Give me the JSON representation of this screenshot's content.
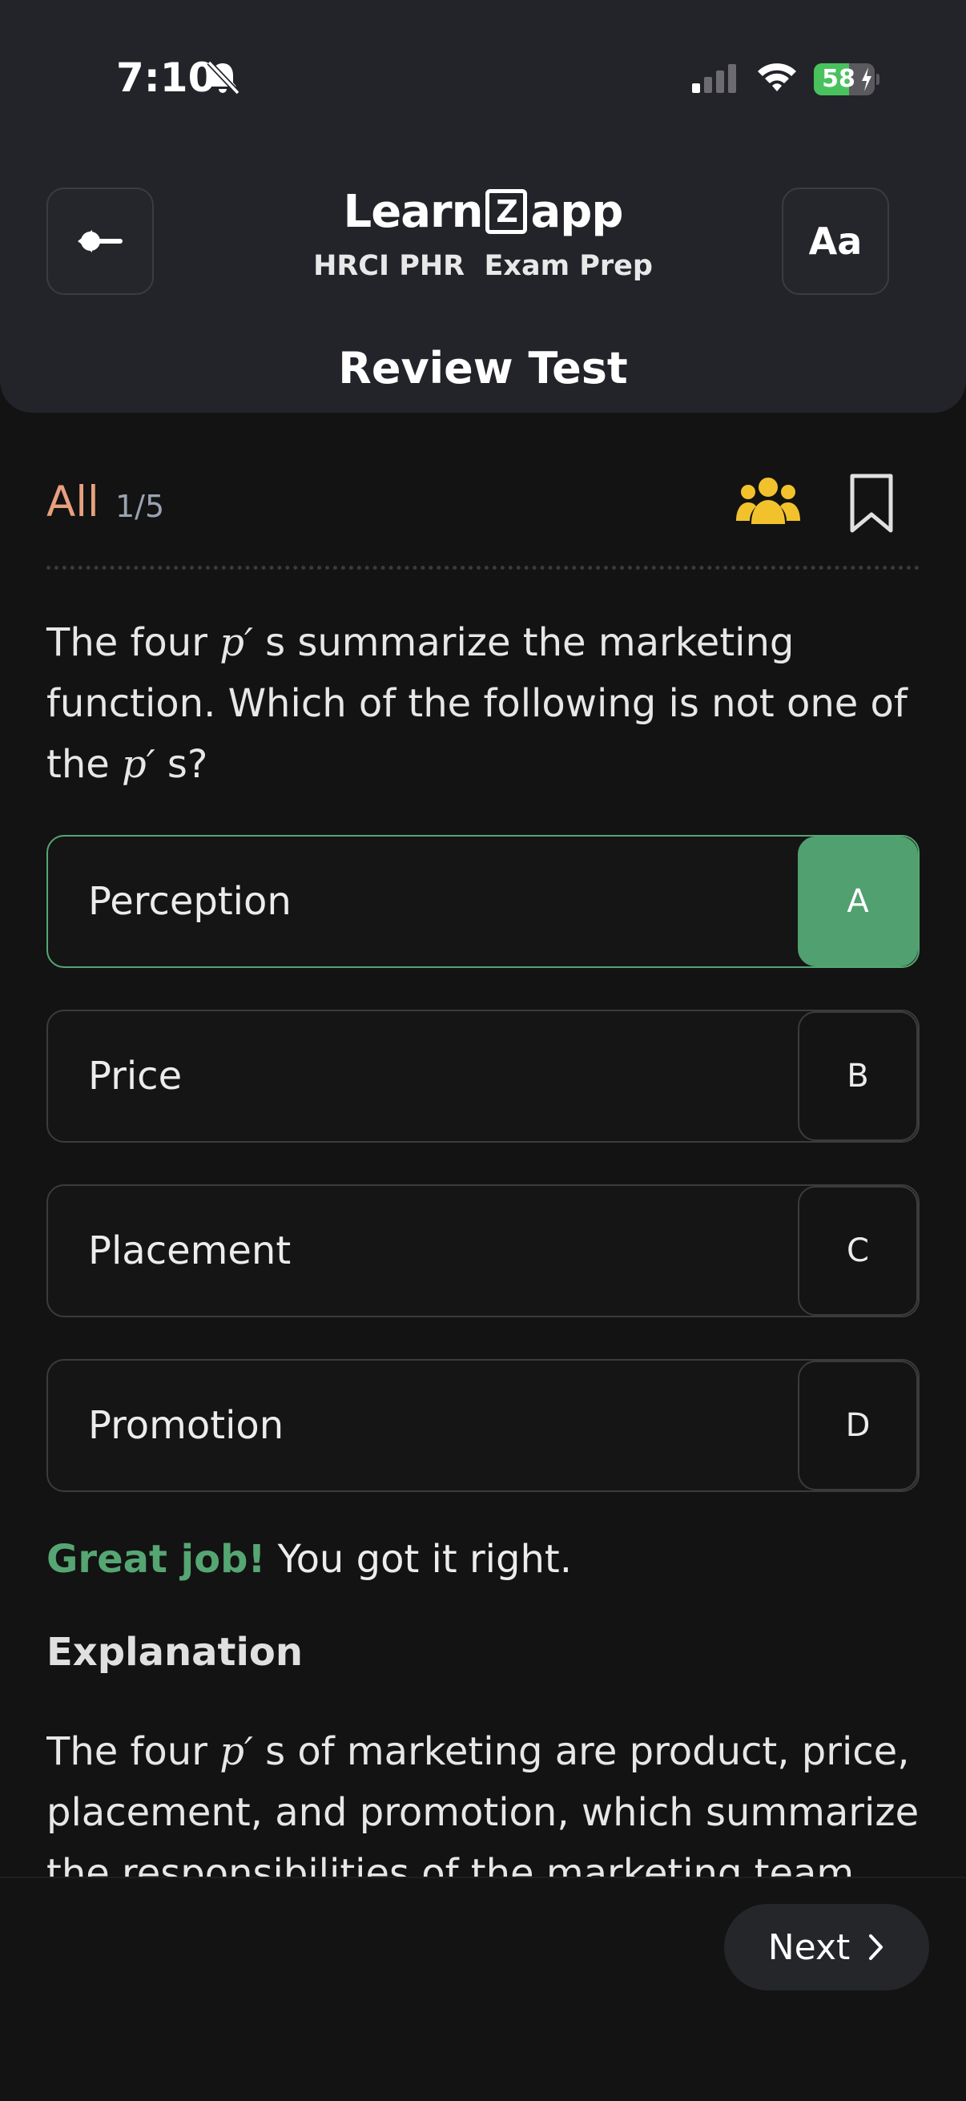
{
  "status_bar": {
    "time": "7:10",
    "battery": "58",
    "battery_level": 0.58,
    "icons": [
      "bell-slash-icon",
      "cellular-signal-icon",
      "wifi-icon",
      "battery-charging-icon"
    ]
  },
  "header": {
    "logo_left": "Learn",
    "logo_box": "Z",
    "logo_right": "app",
    "subtitle": "HRCI PHR  Exam Prep",
    "title": "Review Test",
    "back_icon": "back-arrow-icon",
    "font_size_label": "Aa"
  },
  "filter": {
    "label": "All",
    "count": "1/5",
    "people_icon": "people-group-icon",
    "people_icon_color": "#f2c22d",
    "bookmark_icon": "bookmark-outline-icon"
  },
  "question": {
    "part1": "The four ",
    "p1": "p′",
    "part2": " s summarize the marketing function. Which of the following is not one of the ",
    "p2": "p′",
    "part3": " s?"
  },
  "options": [
    {
      "key": "A",
      "label": "Perception",
      "state": "correct"
    },
    {
      "key": "B",
      "label": "Price",
      "state": "default"
    },
    {
      "key": "C",
      "label": "Placement",
      "state": "default"
    },
    {
      "key": "D",
      "label": "Promotion",
      "state": "default"
    }
  ],
  "result": {
    "highlight": "Great job!",
    "message": " You got it right."
  },
  "explanation": {
    "title": "Explanation",
    "part1": "The four ",
    "p": "p′",
    "part2": " s of marketing are product, price, placement, and promotion, which summarize the responsibilities of the marketing team."
  },
  "footer": {
    "next_label": "Next",
    "next_icon": "chevron-right-icon"
  },
  "colors": {
    "accent_green": "#50a070",
    "filter_orange": "#e8a07e",
    "header_bg": "#232429",
    "page_bg": "#131313"
  }
}
